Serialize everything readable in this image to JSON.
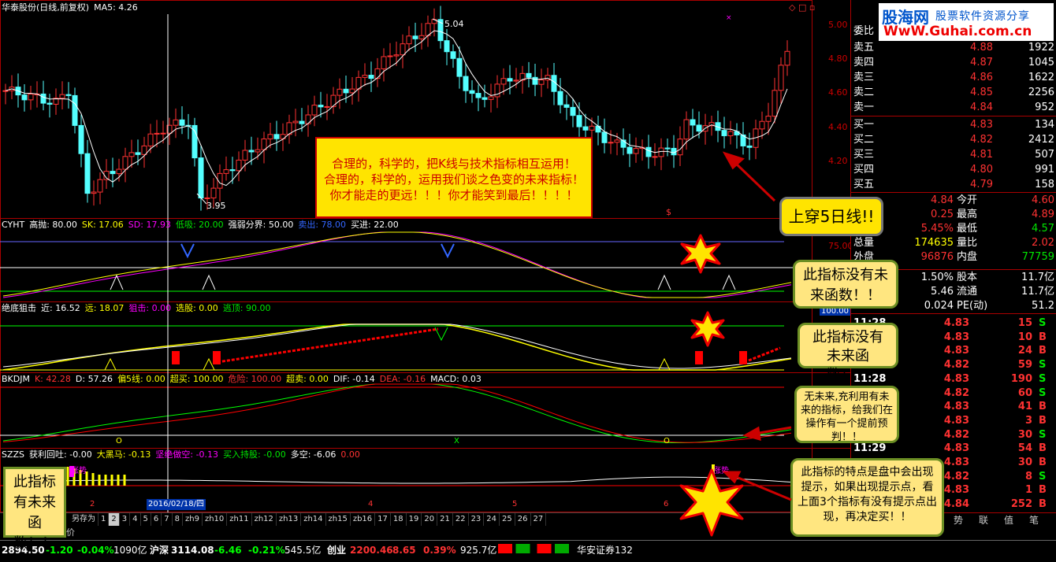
{
  "main": {
    "title": "华泰股份(日线,前复权)",
    "ma_label": "MA5: 4.26",
    "high_label": "5.04",
    "low_label": "3.95",
    "y_ticks": [
      "5.00",
      "4.80",
      "4.60",
      "4.40",
      "4.20"
    ],
    "indicator_ticks": [
      "75.00",
      "100.00"
    ]
  },
  "ind1": {
    "name": "CYHT",
    "items": [
      "高抛: 80.00",
      "SK: 17.06",
      "SD: 17.93",
      "低吸: 20.00",
      "强弱分界: 50.00",
      "卖出: 78.00",
      "买进: 22.00"
    ]
  },
  "ind2": {
    "name": "绝底狙击",
    "items": [
      "近: 16.52",
      "远: 18.07",
      "狙击: 0.00",
      "选股: 0.00",
      "逃顶: 90.00"
    ]
  },
  "ind3": {
    "name": "BKDJM",
    "items": [
      "K: 42.28",
      "D: 57.26",
      "偏5线: 0.00",
      "超买: 100.00",
      "危险: 100.00",
      "超卖: 0.00",
      "DIF: -0.14",
      "DEA: -0.16",
      "MACD: 0.03"
    ]
  },
  "ind4": {
    "name": "SZZS",
    "items": [
      "获利回吐: -0.00",
      "大黑马: -0.13",
      "坚绝做空: -0.13",
      "买入持股: -0.00",
      "多空: -6.06",
      "0.00"
    ]
  },
  "marks": {
    "ind3_o1": "O",
    "ind3_x": "X",
    "ind3_o2": "O",
    "ind4_up1": "涨势",
    "ind4_up2": "涨势",
    "dollar": "$"
  },
  "x_axis": {
    "date_label": "2016/02/18/四",
    "months": [
      "2",
      "4",
      "5",
      "6"
    ]
  },
  "tabs": [
    "另存为",
    "1",
    "2",
    "3",
    "4",
    "5",
    "6",
    "7",
    "8",
    "zh9",
    "zh10",
    "zh11",
    "zh12",
    "zh13",
    "zh14",
    "zh15",
    "zb16",
    "17",
    "18",
    "19",
    "20",
    "21",
    "22",
    "23",
    "24",
    "25",
    "26",
    "27"
  ],
  "tabs_left": "价",
  "order_book": {
    "committee": "委比",
    "sells": [
      {
        "label": "卖五",
        "price": "4.88",
        "vol": "1922"
      },
      {
        "label": "卖四",
        "price": "4.87",
        "vol": "1045"
      },
      {
        "label": "卖三",
        "price": "4.86",
        "vol": "1622"
      },
      {
        "label": "卖二",
        "price": "4.85",
        "vol": "2256"
      },
      {
        "label": "卖一",
        "price": "4.84",
        "vol": "952"
      }
    ],
    "buys": [
      {
        "label": "买一",
        "price": "4.83",
        "vol": "134"
      },
      {
        "label": "买二",
        "price": "4.82",
        "vol": "2412"
      },
      {
        "label": "买三",
        "price": "4.81",
        "vol": "507"
      },
      {
        "label": "买四",
        "price": "4.80",
        "vol": "991"
      },
      {
        "label": "买五",
        "price": "4.79",
        "vol": "158"
      }
    ]
  },
  "quote": [
    {
      "v": "4.84",
      "label": "今开",
      "v2": "4.60"
    },
    {
      "v": "0.25",
      "label": "最高",
      "v2": "4.89"
    },
    {
      "v": "5.45%",
      "label": "最低",
      "v2": "4.57"
    },
    {
      "pre": "总量",
      "v": "174635",
      "label": "量比",
      "v2": "2.02"
    },
    {
      "pre": "外盘",
      "v": "96876",
      "label": "内盘",
      "v2": "77759"
    },
    {
      "v": "1.50%",
      "label": "股本",
      "v2": "11.7亿"
    },
    {
      "v": "5.46",
      "label": "流通",
      "v2": "11.7亿"
    },
    {
      "v": "0.024",
      "label": "PE(动)",
      "v2": "51.2"
    }
  ],
  "ticks": [
    {
      "t": "11:28",
      "p": "4.83",
      "v": "15",
      "s": "S"
    },
    {
      "t": "",
      "p": "4.83",
      "v": "10",
      "s": "B"
    },
    {
      "t": "",
      "p": "4.83",
      "v": "24",
      "s": "B"
    },
    {
      "t": "",
      "p": "4.82",
      "v": "59",
      "s": "S"
    },
    {
      "t": "11:28",
      "p": "4.83",
      "v": "190",
      "s": "S"
    },
    {
      "t": "",
      "p": "4.82",
      "v": "60",
      "s": "S"
    },
    {
      "t": "",
      "p": "4.83",
      "v": "41",
      "s": "B"
    },
    {
      "t": "",
      "p": "4.83",
      "v": "3",
      "s": "B"
    },
    {
      "t": "",
      "p": "4.82",
      "v": "30",
      "s": "S"
    },
    {
      "t": "11:29",
      "p": "4.83",
      "v": "54",
      "s": "B"
    },
    {
      "t": "",
      "p": "4.83",
      "v": "30",
      "s": "B"
    },
    {
      "t": "",
      "p": "4.82",
      "v": "8",
      "s": "S"
    },
    {
      "t": "",
      "p": "4.83",
      "v": "1",
      "s": "B"
    },
    {
      "t": "",
      "p": "4.84",
      "v": "252",
      "s": "B"
    }
  ],
  "right_tabs": [
    "势",
    "联",
    "值",
    "笔"
  ],
  "status": {
    "idx1": "2894.50",
    "chg1": "-1.20",
    "pct1": "-0.04%",
    "amt1": "1090亿",
    "sh_name": "沪深",
    "idx2": "3114.08",
    "chg2": "-6.46",
    "pct2": "-0.21%",
    "amt2": "545.5亿",
    "cy_name": "创业",
    "idx3": "2200.46",
    "chg3": "8.65",
    "pct3": "0.39%",
    "amt3": "925.7亿",
    "broker": "华安证券132"
  },
  "logo": {
    "line1": "股海网",
    "line2": "股票软件资源分享",
    "url": "WwW.Guhai.com.cn"
  },
  "annotations": {
    "box_main": [
      "合理的，科学的，把K线与技术指标相互运用！",
      "合理的，科学的，运用我们谈之色变的未来指标！",
      "你才能走的更远！！！你才能笑到最后！！！！"
    ],
    "shang_chuan": "上穿5日线!!",
    "no_future_1": "此指标没有未来函数！！",
    "no_future_2": "此指标没有未来函数！！",
    "wu_weilai": "无未来,充利用有未来的指标，给我们在操作有一个提前预判！！",
    "tedian": "此指标的特点是盘中会出现提示，如果出现提示点，看上面3个指标有没有提示点出现，再决定买！！",
    "left_note": "此指标有未来函数！！"
  }
}
